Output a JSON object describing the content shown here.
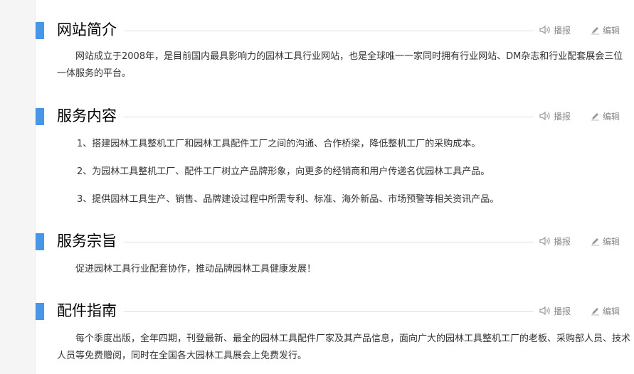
{
  "actions": {
    "speak_label": "播报",
    "edit_label": "编辑"
  },
  "sections": [
    {
      "title": "网站简介",
      "paragraphs": [
        "网站成立于2008年，是目前国内最具影响力的园林工具行业网站，也是全球唯一一家同时拥有行业网站、DM杂志和行业配套展会三位一体服务的平台。"
      ]
    },
    {
      "title": "服务内容",
      "items": [
        "1、搭建园林工具整机工厂和园林工具配件工厂之间的沟通、合作桥梁，降低整机工厂的采购成本。",
        "2、为园林工具整机工厂、配件工厂树立产品牌形象，向更多的经销商和用户传递名优园林工具产品。",
        "3、提供园林工具生产、销售、品牌建设过程中所需专利、标准、海外新品、市场预警等相关资讯产品。"
      ]
    },
    {
      "title": "服务宗旨",
      "paragraphs": [
        "促进园林工具行业配套协作，推动品牌园林工具健康发展！"
      ]
    },
    {
      "title": "配件指南",
      "paragraphs": [
        "每个季度出版，全年四期，刊登最新、最全的园林工具配件厂家及其产品信息，面向广大的园林工具整机工厂的老板、采购部人员、技术人员等免费赠阅，同时在全国各大园林工具展会上免费发行。"
      ]
    }
  ],
  "colors": {
    "accent": "#4796e7",
    "text": "#333333",
    "muted": "#888888",
    "rule": "#e0e0e0"
  },
  "icons": {
    "speak": "speaker-icon",
    "edit": "pencil-icon"
  }
}
